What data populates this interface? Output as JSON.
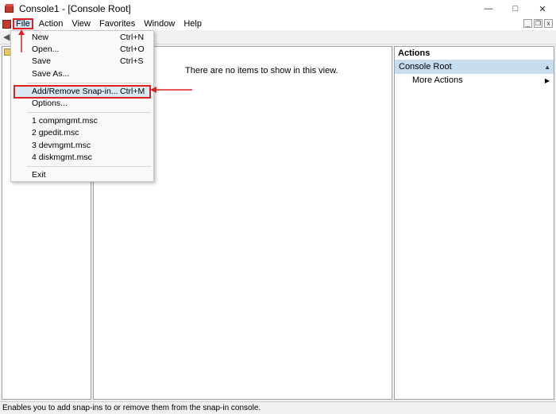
{
  "window": {
    "title": "Console1 - [Console Root]",
    "minimize": "—",
    "maximize": "□",
    "close": "✕"
  },
  "menubar": {
    "items": [
      "File",
      "Action",
      "View",
      "Favorites",
      "Window",
      "Help"
    ],
    "mdi": {
      "minimize": "_",
      "restore": "❐",
      "close": "x"
    }
  },
  "toolbar": {
    "back_icon": "arrow-left-icon"
  },
  "center": {
    "empty_message": "There are no items to show in this view."
  },
  "actions": {
    "header": "Actions",
    "section": "Console Root",
    "items": [
      "More Actions"
    ]
  },
  "file_menu": {
    "items": [
      {
        "label": "New",
        "shortcut": "Ctrl+N"
      },
      {
        "label": "Open...",
        "shortcut": "Ctrl+O"
      },
      {
        "label": "Save",
        "shortcut": "Ctrl+S"
      },
      {
        "label": "Save As...",
        "shortcut": ""
      },
      {
        "label": "Add/Remove Snap-in...",
        "shortcut": "Ctrl+M"
      },
      {
        "label": "Options...",
        "shortcut": ""
      },
      {
        "label": "1 compmgmt.msc",
        "shortcut": ""
      },
      {
        "label": "2 gpedit.msc",
        "shortcut": ""
      },
      {
        "label": "3 devmgmt.msc",
        "shortcut": ""
      },
      {
        "label": "4 diskmgmt.msc",
        "shortcut": ""
      },
      {
        "label": "Exit",
        "shortcut": ""
      }
    ]
  },
  "statusbar": {
    "text": "Enables you to add snap-ins to or remove them from the snap-in console."
  },
  "colors": {
    "annotation": "#e02020",
    "highlight": "#dbe9f7",
    "actions_section": "#c6ddf0"
  }
}
